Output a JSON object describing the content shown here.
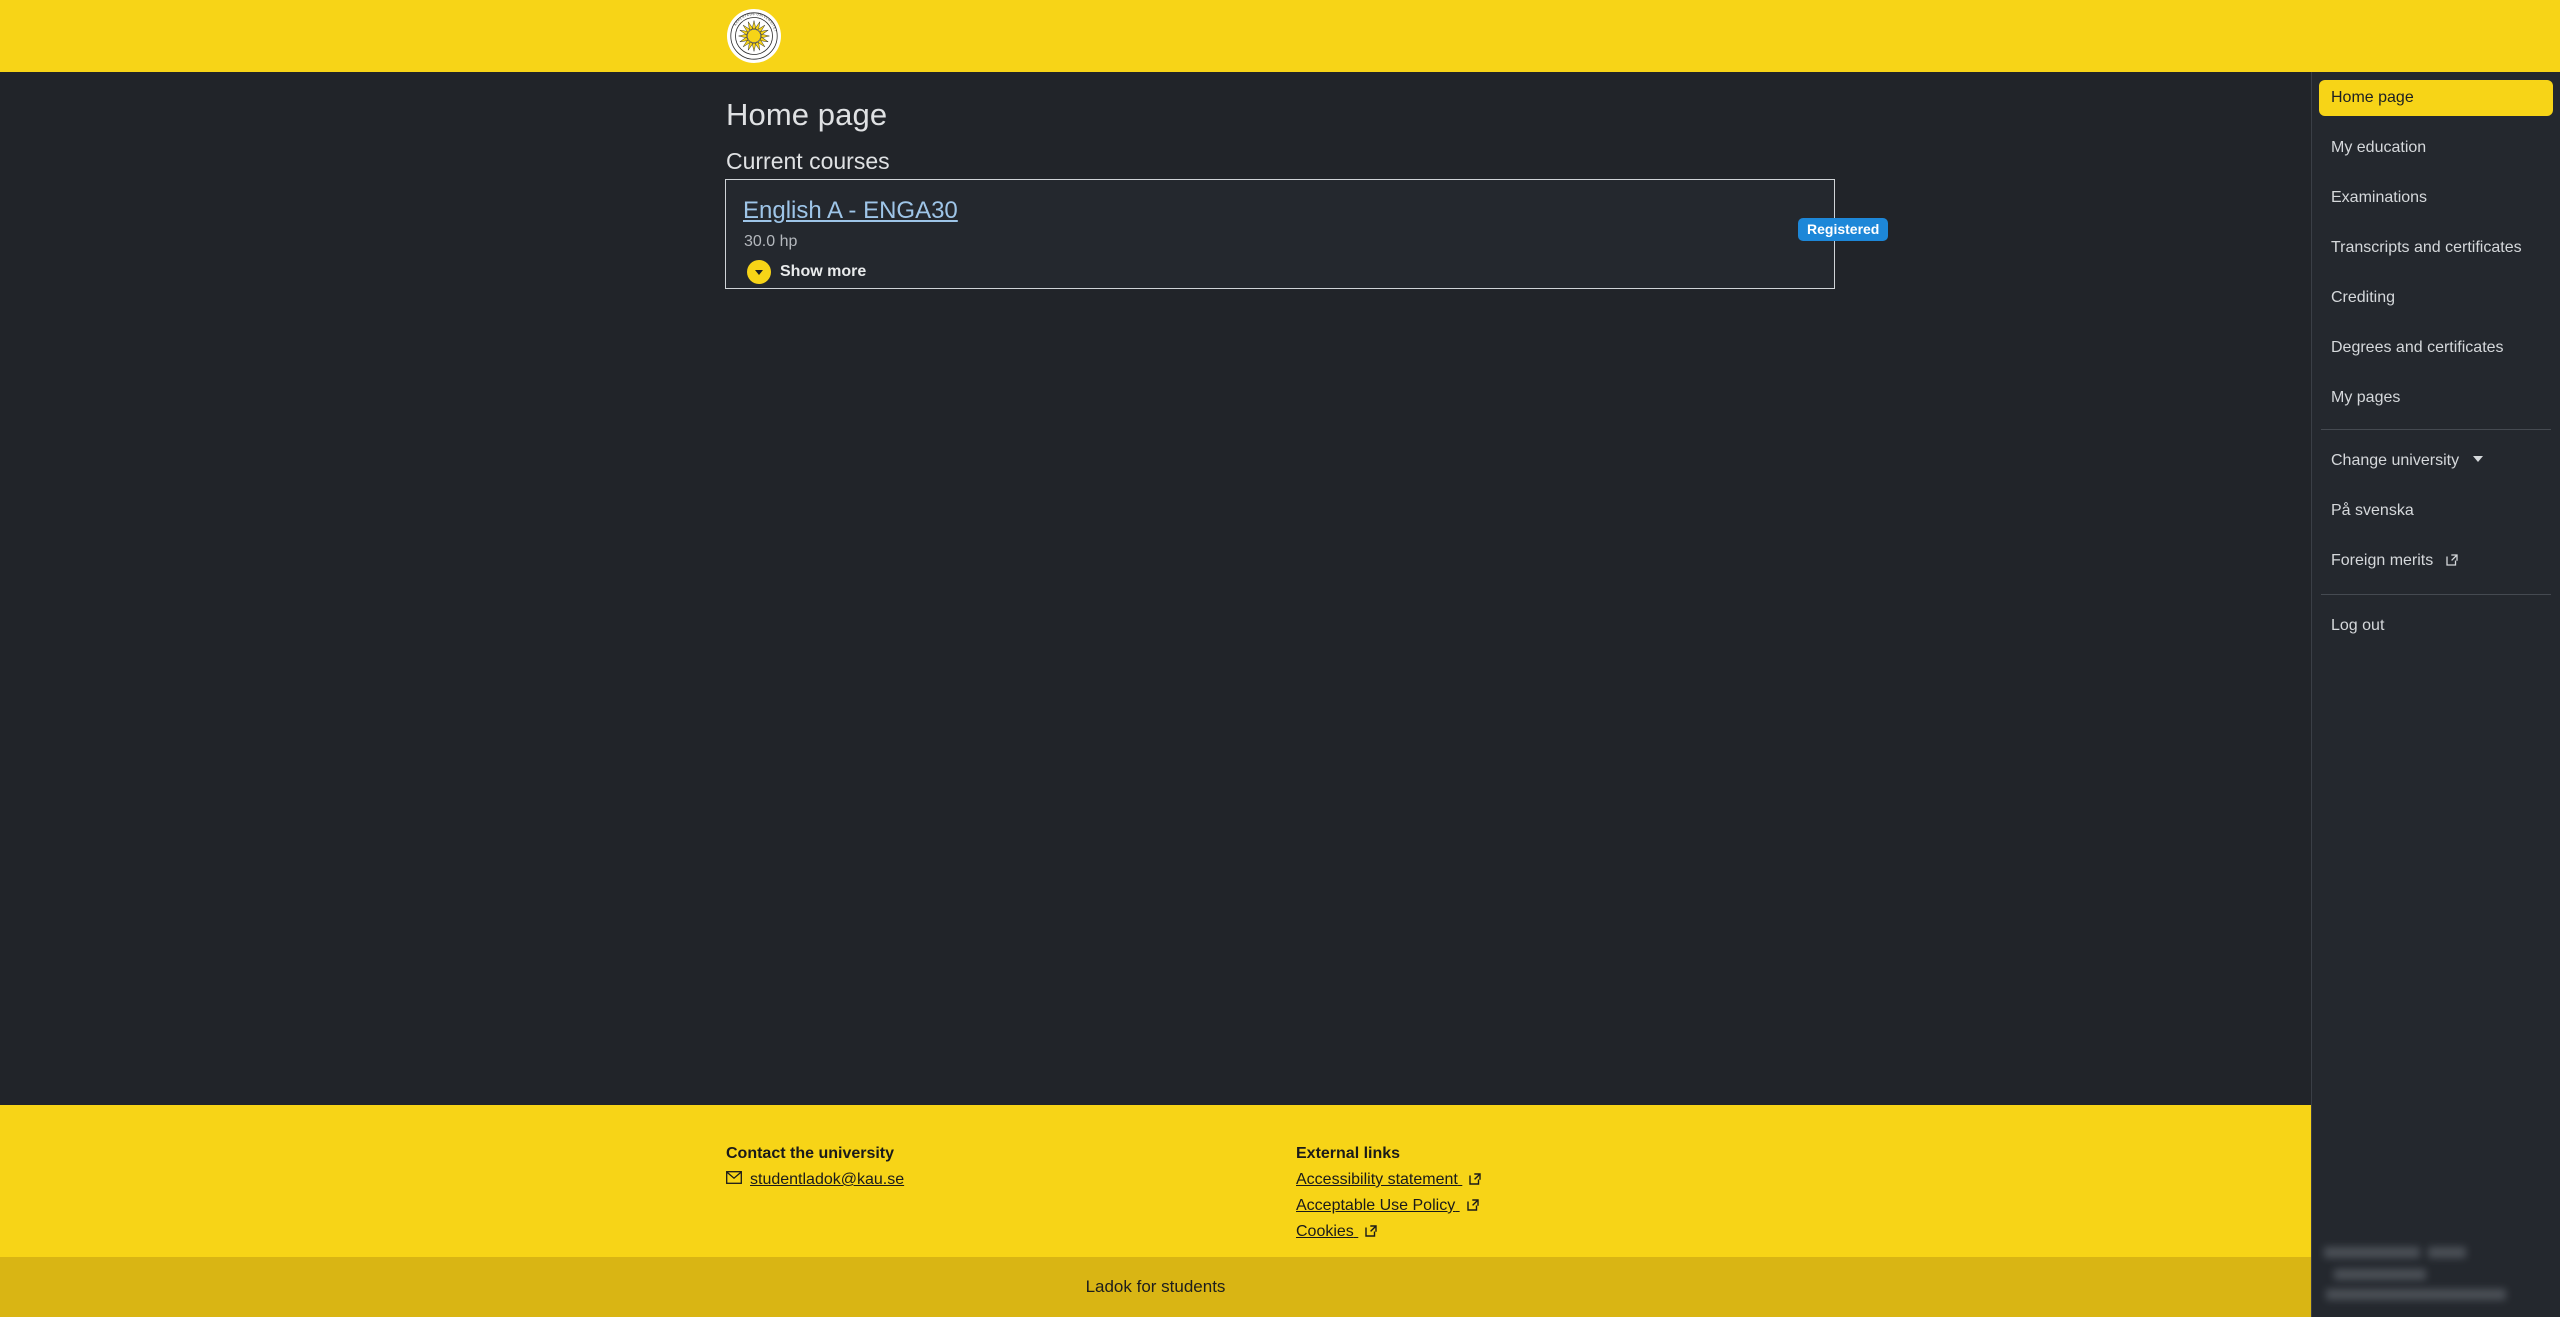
{
  "header": {
    "logo_alt": "Karlstads universitet",
    "logo_ring_text": "KARLSTADS UNIVERSITET"
  },
  "main": {
    "page_title": "Home page",
    "section_title": "Current courses",
    "course": {
      "title": "English A - ENGA30",
      "credits": "30.0 hp",
      "show_more_label": "Show more",
      "status_badge": "Registered"
    }
  },
  "sidebar": {
    "items": [
      {
        "label": "Home page",
        "active": true,
        "external": false,
        "caret": false
      },
      {
        "label": "My education",
        "active": false,
        "external": false,
        "caret": false
      },
      {
        "label": "Examinations",
        "active": false,
        "external": false,
        "caret": false
      },
      {
        "label": "Transcripts and certificates",
        "active": false,
        "external": false,
        "caret": false
      },
      {
        "label": "Crediting",
        "active": false,
        "external": false,
        "caret": false
      },
      {
        "label": "Degrees and certificates",
        "active": false,
        "external": false,
        "caret": false
      },
      {
        "label": "My pages",
        "active": false,
        "external": false,
        "caret": false
      }
    ],
    "items_secondary": [
      {
        "label": "Change university",
        "active": false,
        "external": false,
        "caret": true
      },
      {
        "label": "På svenska",
        "active": false,
        "external": false,
        "caret": false
      },
      {
        "label": "Foreign merits",
        "active": false,
        "external": true,
        "caret": false
      }
    ],
    "items_tertiary": [
      {
        "label": "Log out",
        "active": false,
        "external": false,
        "caret": false
      }
    ]
  },
  "footer": {
    "contact_heading": "Contact the university",
    "contact_email": "studentladok@kau.se",
    "links_heading": "External links",
    "links": [
      {
        "label": "Accessibility statement"
      },
      {
        "label": "Acceptable Use Policy"
      },
      {
        "label": "Cookies"
      }
    ]
  },
  "bottom_bar": {
    "label": "Ladok for students"
  },
  "colors": {
    "brand_yellow": "#f7d417",
    "bottom_bar_yellow": "#d9b514",
    "page_background": "#212429",
    "panel_background": "#24282e",
    "badge_blue": "#1d87d8",
    "link_blue": "#9ec5e8",
    "text_light": "#dfe1e3"
  }
}
